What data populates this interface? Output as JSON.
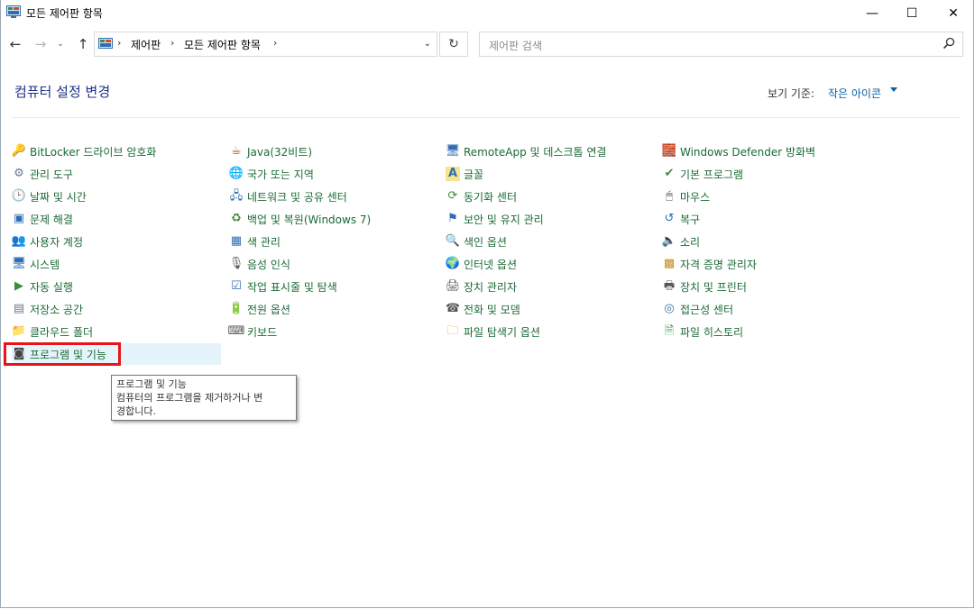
{
  "window": {
    "title": "모든 제어판 항목",
    "min_glyph": "—",
    "max_glyph": "☐",
    "close_glyph": "✕"
  },
  "nav": {
    "back_glyph": "←",
    "forward_glyph": "→",
    "recent_glyph": "⌄",
    "up_glyph": "↑",
    "breadcrumb": [
      "제어판",
      "모든 제어판 항목"
    ],
    "crumb_separator": "›",
    "dropdown_glyph": "⌄",
    "refresh_glyph": "↻"
  },
  "search": {
    "placeholder": "제어판 검색"
  },
  "header": {
    "title": "컴퓨터 설정 변경",
    "view_by_label": "보기 기준:",
    "view_by_value": "작은 아이콘"
  },
  "columns": [
    {
      "items": [
        {
          "label": "BitLocker 드라이브 암호화",
          "icon": "bitlocker-icon"
        },
        {
          "label": "관리 도구",
          "icon": "admin-tools-icon"
        },
        {
          "label": "날짜 및 시간",
          "icon": "date-time-icon"
        },
        {
          "label": "문제 해결",
          "icon": "troubleshooting-icon"
        },
        {
          "label": "사용자 계정",
          "icon": "user-accounts-icon"
        },
        {
          "label": "시스템",
          "icon": "system-icon"
        },
        {
          "label": "자동 실행",
          "icon": "autoplay-icon"
        },
        {
          "label": "저장소 공간",
          "icon": "storage-spaces-icon"
        },
        {
          "label": "클라우드 폴더",
          "icon": "work-folders-icon"
        },
        {
          "label": "프로그램 및 기능",
          "icon": "programs-features-icon"
        }
      ]
    },
    {
      "items": [
        {
          "label": "Java(32비트)",
          "icon": "java-icon"
        },
        {
          "label": "국가 또는 지역",
          "icon": "region-icon"
        },
        {
          "label": "네트워크 및 공유 센터",
          "icon": "network-icon"
        },
        {
          "label": "백업 및 복원(Windows 7)",
          "icon": "backup-icon"
        },
        {
          "label": "색 관리",
          "icon": "color-management-icon"
        },
        {
          "label": "음성 인식",
          "icon": "speech-icon"
        },
        {
          "label": "작업 표시줄 및 탐색",
          "icon": "taskbar-icon"
        },
        {
          "label": "전원 옵션",
          "icon": "power-icon"
        },
        {
          "label": "키보드",
          "icon": "keyboard-icon"
        }
      ]
    },
    {
      "items": [
        {
          "label": "RemoteApp 및 데스크톱 연결",
          "icon": "remoteapp-icon"
        },
        {
          "label": "글꼴",
          "icon": "fonts-icon"
        },
        {
          "label": "동기화 센터",
          "icon": "sync-center-icon"
        },
        {
          "label": "보안 및 유지 관리",
          "icon": "security-flag-icon"
        },
        {
          "label": "색인 옵션",
          "icon": "indexing-icon"
        },
        {
          "label": "인터넷 옵션",
          "icon": "internet-options-icon"
        },
        {
          "label": "장치 관리자",
          "icon": "device-manager-icon"
        },
        {
          "label": "전화 및 모뎀",
          "icon": "phone-modem-icon"
        },
        {
          "label": "파일 탐색기 옵션",
          "icon": "folder-options-icon"
        }
      ]
    },
    {
      "items": [
        {
          "label": "Windows Defender 방화벽",
          "icon": "firewall-icon"
        },
        {
          "label": "기본 프로그램",
          "icon": "default-programs-icon"
        },
        {
          "label": "마우스",
          "icon": "mouse-icon"
        },
        {
          "label": "복구",
          "icon": "recovery-icon"
        },
        {
          "label": "소리",
          "icon": "sound-icon"
        },
        {
          "label": "자격 증명 관리자",
          "icon": "credential-manager-icon"
        },
        {
          "label": "장치 및 프린터",
          "icon": "devices-printers-icon"
        },
        {
          "label": "접근성 센터",
          "icon": "ease-of-access-icon"
        },
        {
          "label": "파일 히스토리",
          "icon": "file-history-icon"
        }
      ]
    }
  ],
  "tooltip": {
    "title": "프로그램 및 기능",
    "line1": "컴퓨터의 프로그램을 제거하거나 변",
    "line2": "경합니다."
  },
  "colors": {
    "link_green": "#1a6a35",
    "heading_blue": "#1e3287",
    "accent_blue": "#0a5ea8",
    "hover_bg": "#e5f3fb",
    "highlight_red": "#e8141a"
  }
}
